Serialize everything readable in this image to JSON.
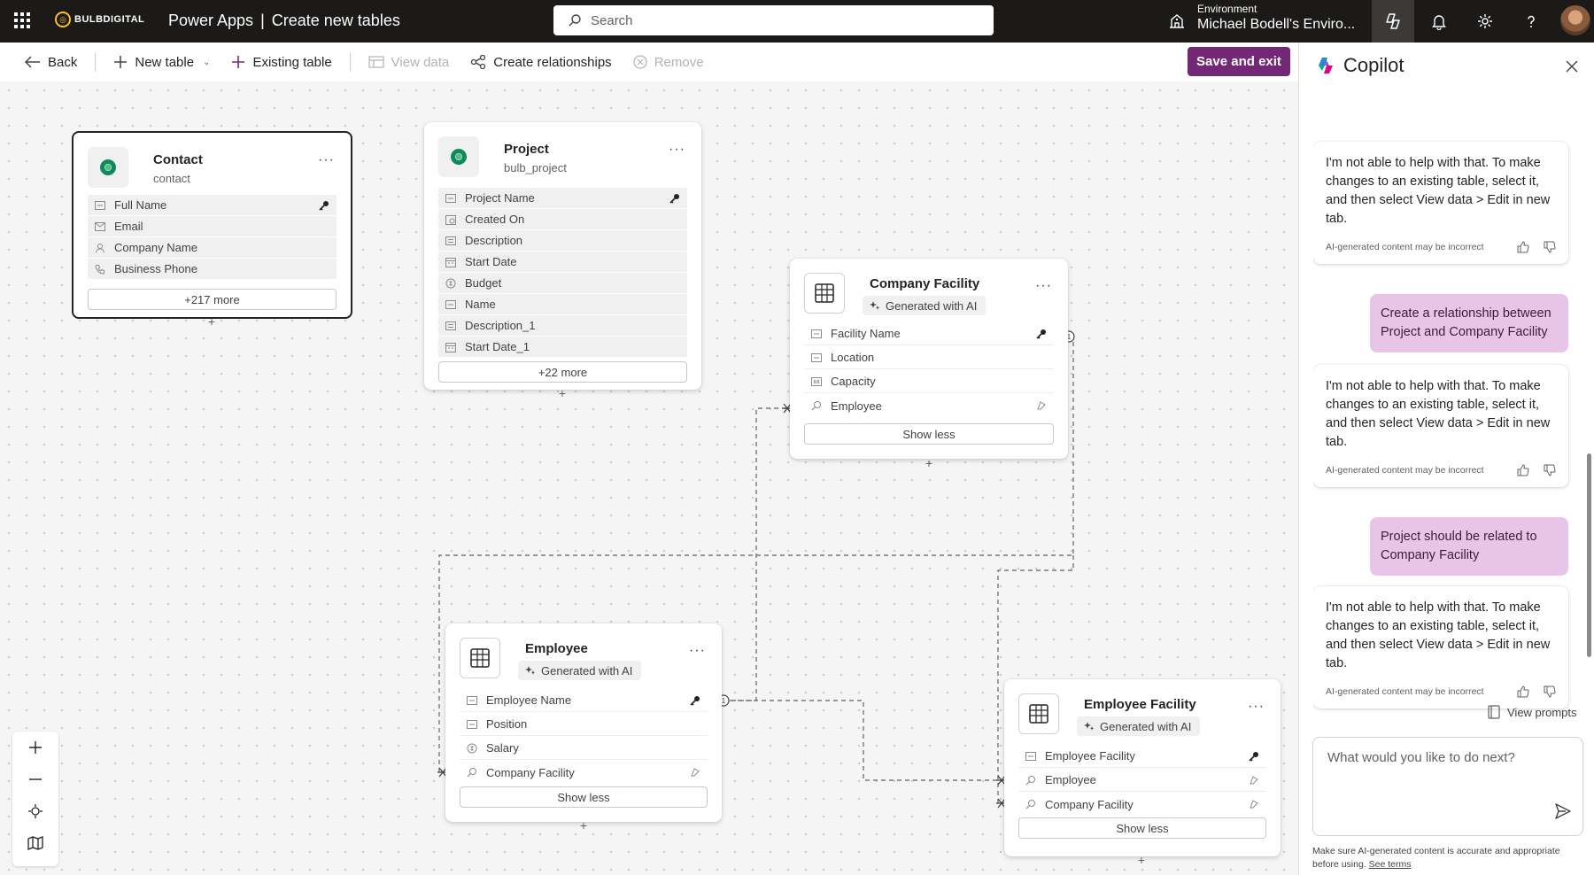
{
  "topbar": {
    "brand": "BULBDIGITAL",
    "app_name": "Power Apps",
    "separator": "|",
    "page_title": "Create new tables",
    "search_placeholder": "Search",
    "environment_label": "Environment",
    "environment_name": "Michael Bodell's Enviro...",
    "icons": [
      "waffle-icon",
      "search-icon",
      "environment-icon",
      "copilot-icon",
      "bell-icon",
      "gear-icon",
      "help-icon"
    ]
  },
  "commandbar": {
    "back": "Back",
    "new_table": "New table",
    "existing_table": "Existing table",
    "view_data": "View data",
    "create_relationships": "Create relationships",
    "remove": "Remove",
    "save_exit": "Save and exit"
  },
  "tables": {
    "contact": {
      "title": "Contact",
      "subtitle": "contact",
      "rows": [
        "Full Name",
        "Email",
        "Company Name",
        "Business Phone"
      ],
      "more": "+217 more"
    },
    "project": {
      "title": "Project",
      "subtitle": "bulb_project",
      "rows": [
        "Project Name",
        "Created On",
        "Description",
        "Start Date",
        "Budget",
        "Name",
        "Description_1",
        "Start Date_1"
      ],
      "more": "+22 more"
    },
    "company_facility": {
      "title": "Company Facility",
      "badge": "Generated with AI",
      "rows": [
        "Facility Name",
        "Location",
        "Capacity",
        "Employee"
      ],
      "less": "Show less"
    },
    "employee": {
      "title": "Employee",
      "badge": "Generated with AI",
      "rows": [
        "Employee Name",
        "Position",
        "Salary",
        "Company Facility"
      ],
      "less": "Show less"
    },
    "employee_facility": {
      "title": "Employee Facility",
      "badge": "Generated with AI",
      "rows": [
        "Employee Facility",
        "Employee",
        "Company Facility"
      ],
      "less": "Show less"
    }
  },
  "copilot": {
    "title": "Copilot",
    "messages": [
      {
        "role": "bot",
        "text": "I'm not able to help with that. To make changes to an existing table, select it, and then select View data > Edit in new tab."
      },
      {
        "role": "user",
        "text": "Create a relationship between Project and Company Facility"
      },
      {
        "role": "bot",
        "text": "I'm not able to help with that. To make changes to an existing table, select it, and then select View data > Edit in new tab."
      },
      {
        "role": "user",
        "text": "Project should be related to Company Facility"
      },
      {
        "role": "bot",
        "text": "I'm not able to help with that. To make changes to an existing table, select it, and then select View data > Edit in new tab."
      }
    ],
    "disclaimer": "AI-generated content may be incorrect",
    "view_prompts": "View prompts",
    "input_placeholder": "What would you like to do next?",
    "footer_text": "Make sure AI-generated content is accurate and appropriate before using.",
    "footer_link": "See terms"
  },
  "colors": {
    "accent": "#742774",
    "topbar_bg": "#1b1a19",
    "user_bubble": "#e8c5e8"
  }
}
